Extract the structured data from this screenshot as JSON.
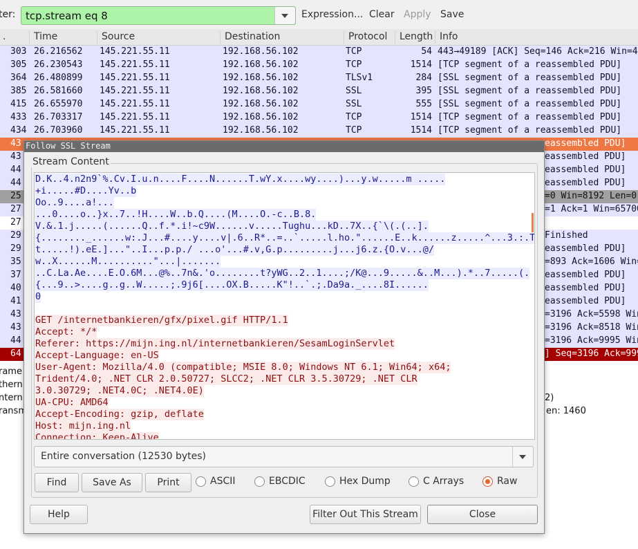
{
  "filter": {
    "label": "ter:",
    "value": "tcp.stream eq 8",
    "expression_label": "Expression...",
    "clear_label": "Clear",
    "apply_label": "Apply",
    "save_label": "Save"
  },
  "columns": [
    ".",
    "Time",
    "Source",
    "Destination",
    "Protocol",
    "Length",
    "Info"
  ],
  "packets": [
    {
      "no": "303",
      "time": "26.216562",
      "src": "145.221.55.11",
      "dst": "192.168.56.102",
      "proto": "TCP",
      "len": "54",
      "info": "443→49189 [ACK] Seq=146 Ack=216 Win=4"
    },
    {
      "no": "305",
      "time": "26.230543",
      "src": "145.221.55.11",
      "dst": "192.168.56.102",
      "proto": "TCP",
      "len": "1514",
      "info": "[TCP segment of a reassembled PDU]"
    },
    {
      "no": "364",
      "time": "26.480899",
      "src": "145.221.55.11",
      "dst": "192.168.56.102",
      "proto": "TLSv1",
      "len": "284",
      "info": "[SSL segment of a reassembled PDU]"
    },
    {
      "no": "385",
      "time": "26.581660",
      "src": "145.221.55.11",
      "dst": "192.168.56.102",
      "proto": "SSL",
      "len": "395",
      "info": "[SSL segment of a reassembled PDU]"
    },
    {
      "no": "415",
      "time": "26.655970",
      "src": "145.221.55.11",
      "dst": "192.168.56.102",
      "proto": "SSL",
      "len": "555",
      "info": "[SSL segment of a reassembled PDU]"
    },
    {
      "no": "433",
      "time": "26.703317",
      "src": "145.221.55.11",
      "dst": "192.168.56.102",
      "proto": "TCP",
      "len": "1514",
      "info": "[TCP segment of a reassembled PDU]"
    },
    {
      "no": "434",
      "time": "26.703960",
      "src": "145.221.55.11",
      "dst": "192.168.56.102",
      "proto": "TCP",
      "len": "1514",
      "info": "[TCP segment of a reassembled PDU]"
    }
  ],
  "hidden_rows": [
    {
      "left": "43",
      "right": "eassembled PDU]",
      "style": "selected"
    },
    {
      "left": "43",
      "right": "eassembled PDU]",
      "style": "normal"
    },
    {
      "left": "44",
      "right": "eassembled PDU]",
      "style": "normal"
    },
    {
      "left": "44",
      "right": "eassembled PDU]",
      "style": "normal"
    },
    {
      "left": "25",
      "right": "=0 Win=8192 Len=0",
      "style": "gray"
    },
    {
      "left": "27",
      "right": "=1 Ack=1 Win=65700",
      "style": "normal"
    },
    {
      "left": "27",
      "right": "",
      "style": "white"
    },
    {
      "left": "29",
      "right": " Finished",
      "style": "normal"
    },
    {
      "left": "29",
      "right": "eassembled PDU]",
      "style": "normal"
    },
    {
      "left": "35",
      "right": "=893 Ack=1606 Win=",
      "style": "normal"
    },
    {
      "left": "37",
      "right": "eassembled PDU]",
      "style": "normal"
    },
    {
      "left": "40",
      "right": "eassembled PDU]",
      "style": "normal"
    },
    {
      "left": "41",
      "right": "eassembled PDU]",
      "style": "normal"
    },
    {
      "left": "43",
      "right": "=3196 Ack=5598 Win",
      "style": "normal"
    },
    {
      "left": "43",
      "right": "=3196 Ack=8518 Win",
      "style": "normal"
    },
    {
      "left": "44",
      "right": "=3196 Ack=9995 Win",
      "style": "normal"
    },
    {
      "left": "64",
      "right": "] Seq=3196 Ack=999",
      "style": "red"
    }
  ],
  "details": [
    {
      "left": "rame",
      "right": ""
    },
    {
      "left": "thern",
      "right": ""
    },
    {
      "left": "ntern",
      "right": "2)"
    },
    {
      "left": "ransm",
      "right": "en: 1460"
    }
  ],
  "dialog": {
    "title": "Follow SSL Stream",
    "group_label": "Stream Content",
    "stream_lines": [
      {
        "text": "D.K..4.n2n9`%.Cv.I.u.n....F....N......T.wY.x....wy....)...y.w.....m .....",
        "dir": "srv"
      },
      {
        "text": "+i.....#D....Yv..b",
        "dir": "srv"
      },
      {
        "text": "Oo..9....a!...",
        "dir": "srv"
      },
      {
        "text": "...0....o..}x..7..!H....W..b.Q....(M....O.-c..B.8.",
        "dir": "srv"
      },
      {
        "text": "V.&.1.j.....(......Q..f.*.i!~c9W......v.....Tughu...kD..7X..{`\\(.(..].",
        "dir": "srv"
      },
      {
        "text": "{........_......w:.J...#....y....v|.6..R*..=..`.....l.ho.\"......E..k......z.....^...3.:.T",
        "dir": "srv"
      },
      {
        "text": "t.....!).eE.]...\"..I...p.p./ ...o'...#.v,G.p.........j...j6.z.{O.v...@/",
        "dir": "srv"
      },
      {
        "text": "w..X......M..........\"...|.......",
        "dir": "srv"
      },
      {
        "text": "..C.La.Ae....E.O.6M...@%..7n&.'o........t?yWG..2..1....;/K@...9.....&..M...).*..7.....(.",
        "dir": "srv"
      },
      {
        "text": "{...9..>....g..g..W.....;.9j6[....OX.B.....K\"!..`.;.Da9a._....8I......",
        "dir": "srv"
      },
      {
        "text": "0",
        "dir": "srv"
      },
      {
        "text": "",
        "dir": "none"
      },
      {
        "text": "GET /internetbankieren/gfx/pixel.gif HTTP/1.1",
        "dir": "cli"
      },
      {
        "text": "Accept: */*",
        "dir": "cli"
      },
      {
        "text": "Referer: https://mijn.ing.nl/internetbankieren/SesamLoginServlet",
        "dir": "cli"
      },
      {
        "text": "Accept-Language: en-US",
        "dir": "cli"
      },
      {
        "text": "User-Agent: Mozilla/4.0 (compatible; MSIE 8.0; Windows NT 6.1; Win64; x64;",
        "dir": "cli"
      },
      {
        "text": "Trident/4.0; .NET CLR 2.0.50727; SLCC2; .NET CLR 3.5.30729; .NET CLR",
        "dir": "cli"
      },
      {
        "text": "3.0.30729; .NET4.0C; .NET4.0E)",
        "dir": "cli"
      },
      {
        "text": "UA-CPU: AMD64",
        "dir": "cli"
      },
      {
        "text": "Accept-Encoding: gzip, deflate",
        "dir": "cli"
      },
      {
        "text": "Host: mijn.ing.nl",
        "dir": "cli"
      },
      {
        "text": "Connection: Keep-Alive",
        "dir": "cli"
      }
    ],
    "conversation": "Entire conversation (12530 bytes)",
    "find_label": "Find",
    "save_as_label": "Save As",
    "print_label": "Print",
    "formats": [
      "ASCII",
      "EBCDIC",
      "Hex Dump",
      "C Arrays",
      "Raw"
    ],
    "selected_format": "Raw",
    "help_label": "Help",
    "filter_out_label": "Filter Out This Stream",
    "close_label": "Close"
  },
  "colors": {
    "filter_valid": "#aef4a8",
    "selected_row": "#ee7744",
    "server_text": "#1a1a8c",
    "client_text": "#8b1010",
    "server_bg": "#ececff",
    "client_bg": "#fbeaea"
  }
}
